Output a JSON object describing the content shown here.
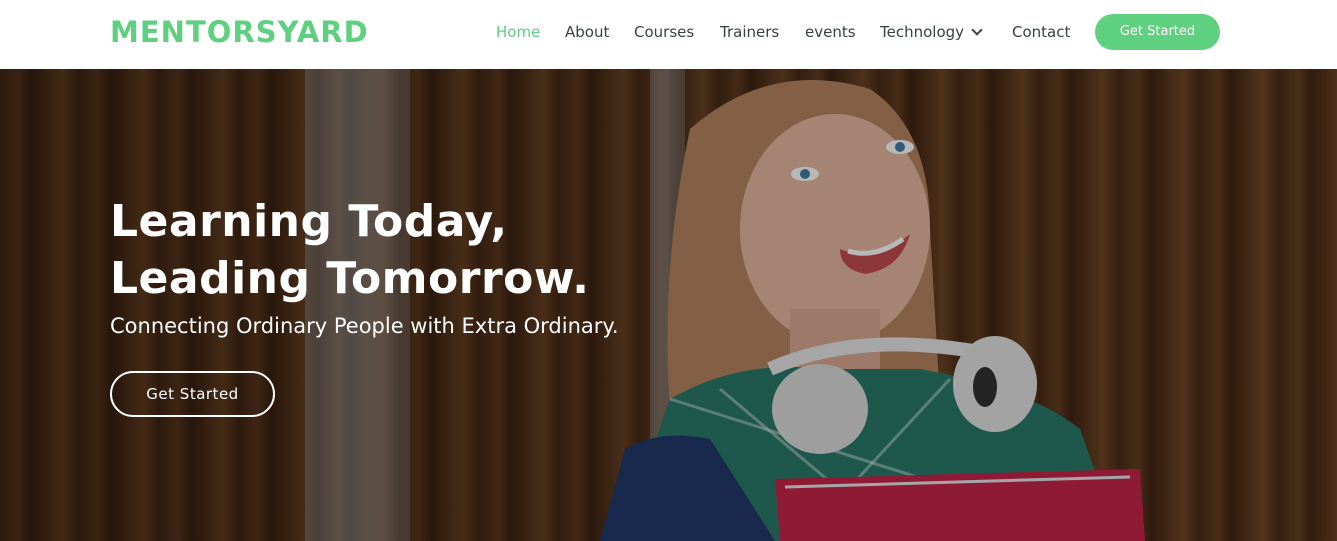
{
  "brand": {
    "logo_text": "MENTORSYARD",
    "accent_color": "#5fcf80"
  },
  "nav": {
    "items": [
      {
        "label": "Home",
        "active": true
      },
      {
        "label": "About"
      },
      {
        "label": "Courses"
      },
      {
        "label": "Trainers"
      },
      {
        "label": "events"
      },
      {
        "label": "Technology",
        "has_dropdown": true,
        "icon": "chevron-down-icon"
      },
      {
        "label": "Contact"
      }
    ],
    "cta_label": "Get Started"
  },
  "hero": {
    "title_line1": "Learning Today,",
    "title_line2": "Leading Tomorrow.",
    "subtitle": "Connecting Ordinary People with Extra Ordinary.",
    "button_label": "Get Started",
    "background": "photo of smiling student with headphones holding a red folder against wooden wall"
  }
}
